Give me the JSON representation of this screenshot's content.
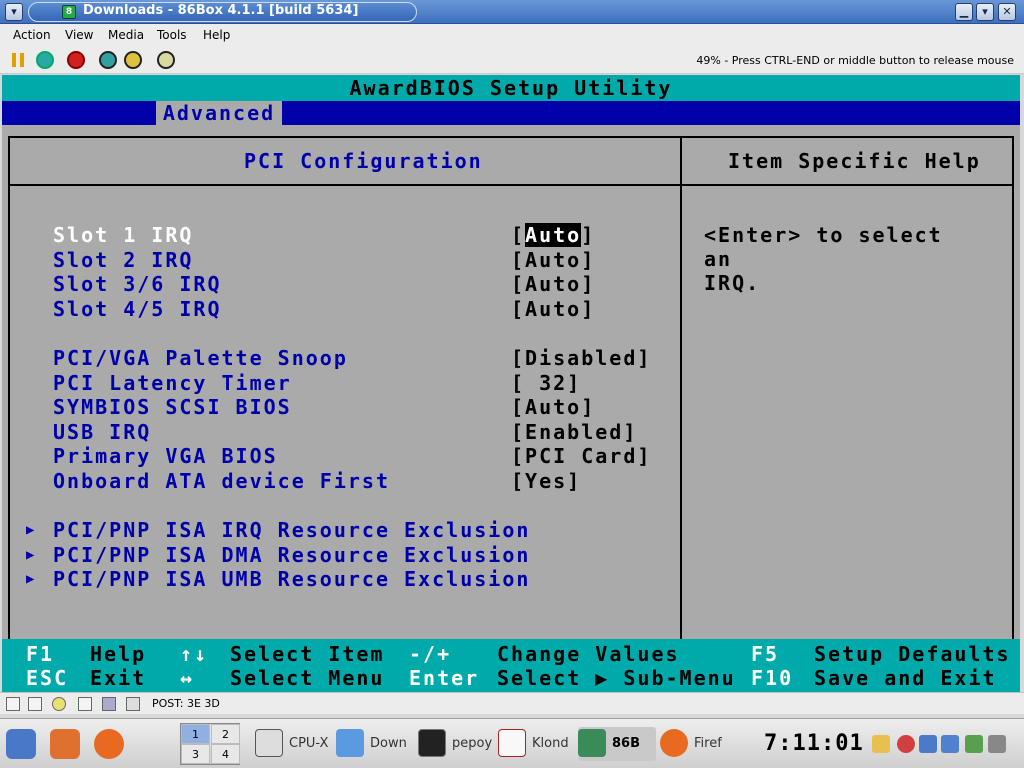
{
  "window": {
    "title": "Downloads - 86Box 4.1.1 [build 5634]"
  },
  "menubar": {
    "items": [
      {
        "label": "Action"
      },
      {
        "label": "View"
      },
      {
        "label": "Media"
      },
      {
        "label": "Tools"
      },
      {
        "label": "Help"
      }
    ]
  },
  "toolbar": {
    "status_text": "49% - Press CTRL-END or middle button to release mouse"
  },
  "bios": {
    "title": "AwardBIOS Setup Utility",
    "active_tab": "Advanced",
    "pane_title": "PCI Configuration",
    "help_title": "Item Specific Help",
    "help_text": "<Enter> to select an\nIRQ.",
    "options": [
      {
        "label": "Slot 1 IRQ",
        "value": "Auto"
      },
      {
        "label": "Slot 2 IRQ",
        "value": "Auto"
      },
      {
        "label": "Slot 3/6 IRQ",
        "value": "Auto"
      },
      {
        "label": "Slot 4/5 IRQ",
        "value": "Auto"
      },
      {
        "label": "PCI/VGA Palette Snoop",
        "value": "Disabled"
      },
      {
        "label": "PCI Latency Timer",
        "value": " 32"
      },
      {
        "label": "SYMBIOS SCSI BIOS",
        "value": "Auto"
      },
      {
        "label": "USB IRQ",
        "value": "Enabled"
      },
      {
        "label": "Primary VGA BIOS",
        "value": "PCI Card"
      },
      {
        "label": "Onboard ATA device First",
        "value": "Yes"
      }
    ],
    "submenus": [
      {
        "label": "PCI/PNP ISA IRQ Resource Exclusion"
      },
      {
        "label": "PCI/PNP ISA DMA Resource Exclusion"
      },
      {
        "label": "PCI/PNP ISA UMB Resource Exclusion"
      }
    ],
    "footer": [
      {
        "key": "F1",
        "desc": "Help"
      },
      {
        "key": "↑↓",
        "desc": "Select Item"
      },
      {
        "key": "-/+",
        "desc": "Change Values"
      },
      {
        "key": "F5",
        "desc": "Setup Defaults"
      },
      {
        "key": "ESC",
        "desc": "Exit"
      },
      {
        "key": "↔",
        "desc": "Select Menu"
      },
      {
        "key": "Enter",
        "desc": "Select ▶ Sub-Menu"
      },
      {
        "key": "F10",
        "desc": "Save and Exit"
      }
    ]
  },
  "statusbar": {
    "text": "POST: 3E 3D"
  },
  "taskbar": {
    "pager": [
      "1",
      "2",
      "3",
      "4"
    ],
    "tasks": [
      {
        "label": "CPU-X"
      },
      {
        "label": "Down"
      },
      {
        "label": "pepoy"
      },
      {
        "label": "Klond"
      },
      {
        "label": "86B"
      },
      {
        "label": "Firef"
      }
    ],
    "clock": "7:11:01"
  }
}
